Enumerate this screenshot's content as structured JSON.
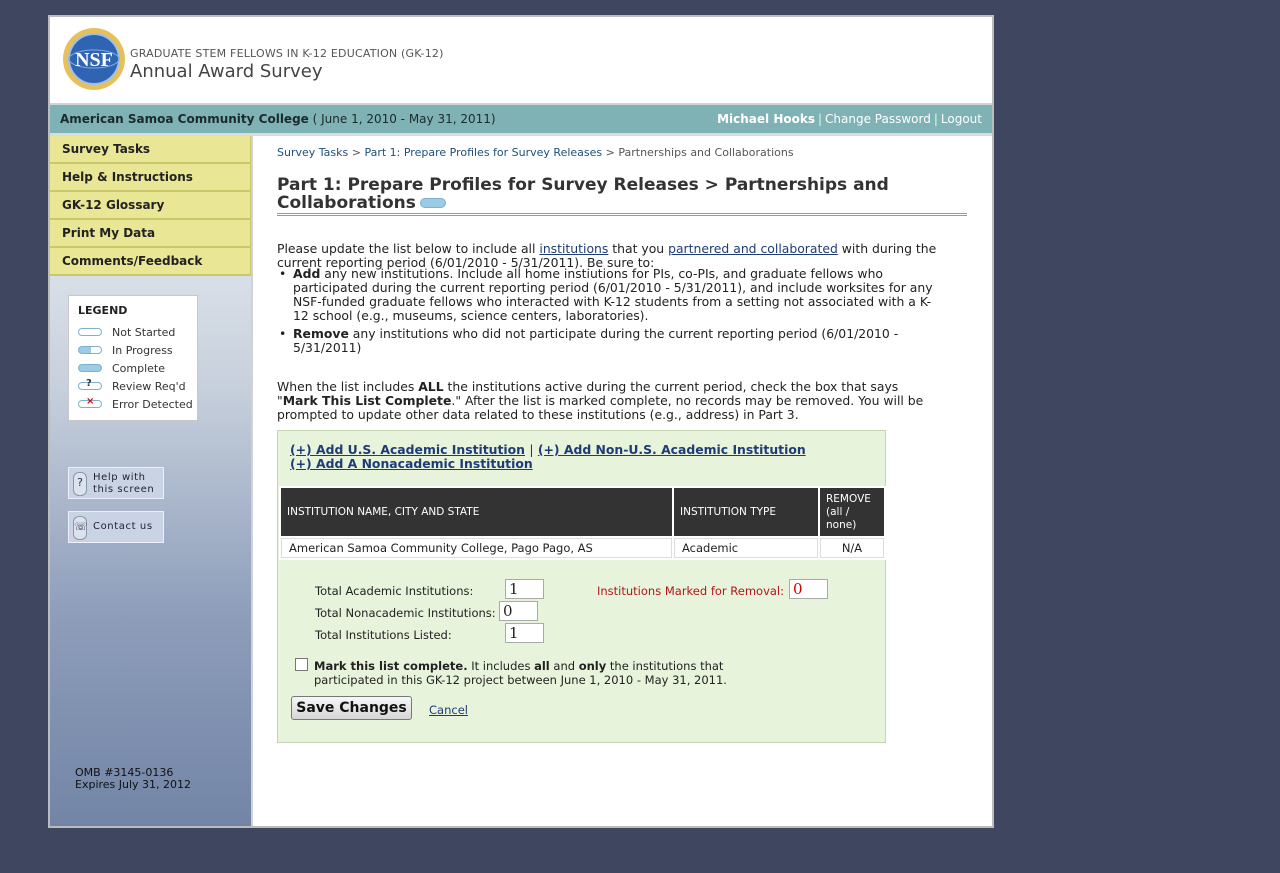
{
  "header": {
    "logo_text": "NSF",
    "program": "GRADUATE STEM FELLOWS IN K-12 EDUCATION (GK-12)",
    "title": "Annual Award Survey"
  },
  "inst_bar": {
    "institution": "American Samoa Community College",
    "period": "( June 1, 2010 - May 31, 2011)",
    "user": "Michael Hooks",
    "change_password": "Change Password",
    "logout": "Logout"
  },
  "sidebar": {
    "nav": [
      "Survey Tasks",
      "Help & Instructions",
      "GK-12 Glossary",
      "Print My Data",
      "Comments/Feedback"
    ],
    "legend_title": "LEGEND",
    "legend": [
      {
        "label": "Not Started",
        "state": "empty"
      },
      {
        "label": "In Progress",
        "state": "half"
      },
      {
        "label": "Complete",
        "state": "full"
      },
      {
        "label": "Review Req'd",
        "mark": "?"
      },
      {
        "label": "Error Detected",
        "mark": "×"
      }
    ],
    "help_btn_line1": "Help with",
    "help_btn_line2": "this screen",
    "contact_btn": "Contact us",
    "omb": "OMB #3145-0136",
    "expires": "Expires July 31, 2012"
  },
  "breadcrumb": {
    "items": [
      "Survey Tasks",
      "Part 1: Prepare Profiles for Survey Releases"
    ],
    "current": "Partnerships and Collaborations",
    "sep": ">"
  },
  "page_title": "Part 1: Prepare Profiles for Survey Releases > Partnerships and Collaborations",
  "intro": {
    "t1": "Please update the list below to include all ",
    "link1": "institutions",
    "t2": " that you ",
    "link2": "partnered and collaborated",
    "t3": " with during the current reporting period (6/01/2010 - 5/31/2011). Be sure to:"
  },
  "bullets": [
    {
      "bold": "Add",
      "text": " any new institutions. Include all home instiutions for PIs, co-PIs, and graduate fellows who participated during the current reporting period (6/01/2010 - 5/31/2011), and include worksites for any NSF-funded graduate fellows who interacted with K-12 students from a setting not associated with a K-12 school (e.g., museums, science centers, laboratories)."
    },
    {
      "bold": "Remove",
      "text": " any institutions who did not participate during the current reporting period (6/01/2010 - 5/31/2011)"
    }
  ],
  "note": {
    "t1": "When the list includes ",
    "b1": "ALL",
    "t2": " the institutions active during the current period, check the box that says \"",
    "b2": "Mark This List Complete",
    "t3": ".\" After the list is marked complete, no records may be removed. You will be prompted to update other data related to these institutions (e.g., address) in Part 3."
  },
  "panel": {
    "add_us": "(+) Add U.S. Academic Institution",
    "add_nonus": "(+) Add Non-U.S. Academic Institution",
    "add_nonacad": "(+) Add A Nonacademic Institution",
    "table": {
      "headers": [
        "INSTITUTION NAME, CITY AND STATE",
        "INSTITUTION TYPE",
        "REMOVE"
      ],
      "remove_all": "all",
      "remove_none": "none",
      "rows": [
        {
          "name": "American Samoa Community College, Pago Pago, AS",
          "type": "Academic",
          "remove": "N/A"
        }
      ]
    },
    "totals": {
      "academic_label": "Total Academic Institutions:",
      "academic_value": "1",
      "nonacademic_label": "Total Nonacademic Institutions:",
      "nonacademic_value": "0",
      "listed_label": "Total Institutions Listed:",
      "listed_value": "1",
      "removal_label": "Institutions Marked for Removal:",
      "removal_value": "0"
    },
    "complete_bold": "Mark this list complete.",
    "complete_t1": " It includes ",
    "complete_b2": "all",
    "complete_t2": " and ",
    "complete_b3": "only",
    "complete_t3": " the institutions that participated in this GK-12 project between June 1, 2010 - May 31, 2011.",
    "save": "Save Changes",
    "cancel": "Cancel"
  }
}
